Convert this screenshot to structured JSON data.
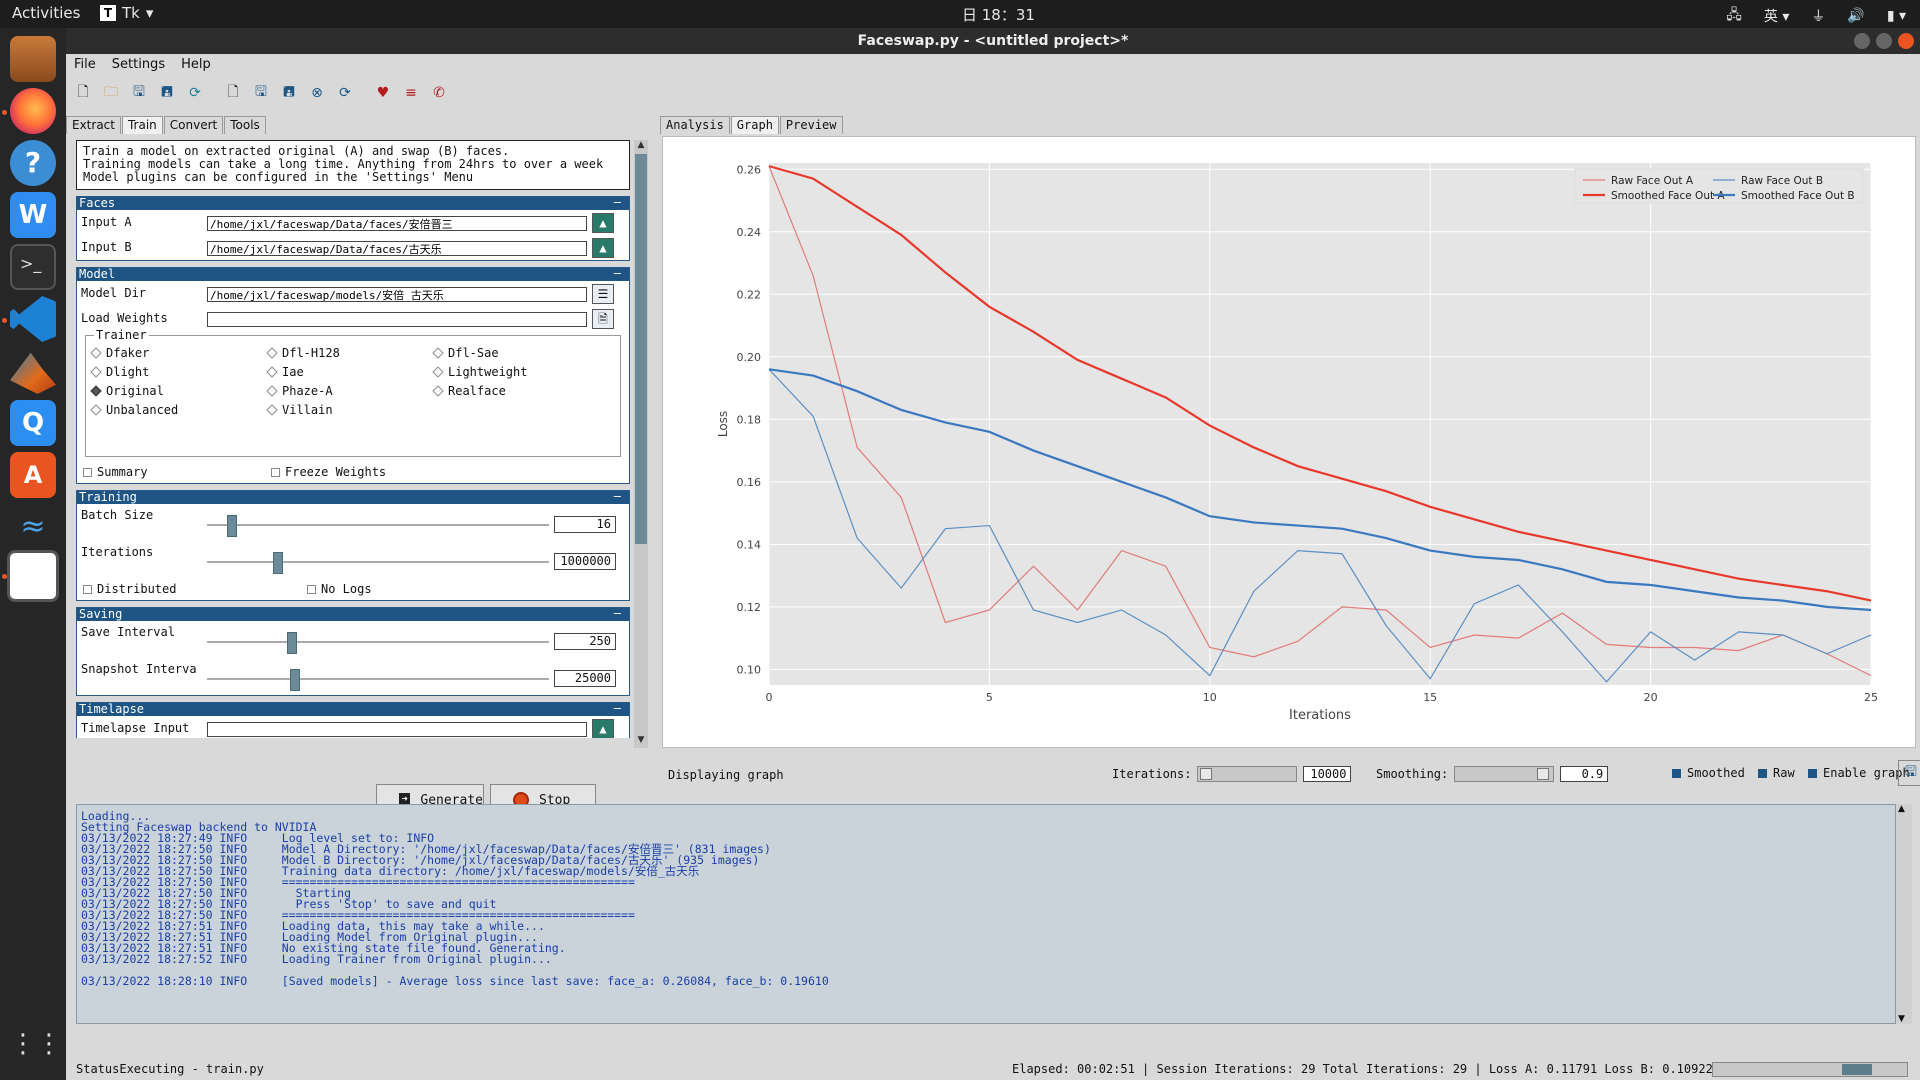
{
  "topbar": {
    "activities": "Activities",
    "app": "Tk",
    "clock": "日 18：31",
    "input_method": "英"
  },
  "dock": {
    "items": [
      "files-icon",
      "firefox-icon",
      "help-icon",
      "wps-icon",
      "terminal-icon",
      "vscode-icon",
      "matlab-icon",
      "qq-icon",
      "software-icon",
      "kali-icon",
      "faceswap-icon",
      "apps-grid-icon"
    ]
  },
  "window": {
    "title": "Faceswap.py - <untitled project>*"
  },
  "menu": {
    "file": "File",
    "settings": "Settings",
    "help": "Help"
  },
  "tabs_left": [
    "Extract",
    "Train",
    "Convert",
    "Tools"
  ],
  "tabs_right": [
    "Analysis",
    "Graph",
    "Preview"
  ],
  "description": {
    "l1": "Train a model on extracted original (A) and swap (B) faces.",
    "l2": "Training models can take a long time. Anything from 24hrs to over a week",
    "l3": "Model plugins can be configured in the 'Settings' Menu"
  },
  "faces": {
    "title": "Faces",
    "input_a_label": "Input A",
    "input_a": "/home/jxl/faceswap/Data/faces/安倍晋三",
    "input_b_label": "Input B",
    "input_b": "/home/jxl/faceswap/Data/faces/古天乐"
  },
  "model": {
    "title": "Model",
    "dir_label": "Model Dir",
    "dir": "/home/jxl/faceswap/models/安倍_古天乐",
    "weights_label": "Load Weights",
    "weights": "",
    "trainer_label": "Trainer",
    "trainers": [
      "Dfaker",
      "Dlight",
      "Original",
      "Unbalanced",
      "Dfl-H128",
      "Iae",
      "Phaze-A",
      "Villain",
      "Dfl-Sae",
      "Lightweight",
      "Realface"
    ],
    "selected_trainer": "Original",
    "summary": "Summary",
    "freeze": "Freeze Weights"
  },
  "training": {
    "title": "Training",
    "batch_label": "Batch Size",
    "batch": "16",
    "batch_level": 0.06,
    "iter_label": "Iterations",
    "iter": "1000000",
    "iter_level": 0.2,
    "distributed": "Distributed",
    "nologs": "No Logs"
  },
  "saving": {
    "title": "Saving",
    "save_label": "Save Interval",
    "save": "250",
    "save_level": 0.24,
    "snap_label": "Snapshot Interva",
    "snap": "25000",
    "snap_level": 0.25
  },
  "timelapse": {
    "title": "Timelapse",
    "input_label": "Timelapse Input"
  },
  "buttons": {
    "generate": "Generate",
    "stop": "Stop"
  },
  "graphbar": {
    "status": "Displaying graph",
    "iter_label": "Iterations:",
    "iter": "10000",
    "smooth_label": "Smoothing:",
    "smooth": "0.9",
    "cb_smoothed": "Smoothed",
    "cb_raw": "Raw",
    "cb_enable": "Enable graph"
  },
  "chart_data": {
    "type": "line",
    "xlabel": "Iterations",
    "ylabel": "Loss",
    "xlim": [
      0,
      25
    ],
    "ylim": [
      0.095,
      0.262
    ],
    "xticks": [
      0,
      5,
      10,
      15,
      20,
      25
    ],
    "yticks": [
      0.1,
      0.12,
      0.14,
      0.16,
      0.18,
      0.2,
      0.22,
      0.24,
      0.26
    ],
    "grid": true,
    "legend_position": "top-right",
    "x": [
      0,
      1,
      2,
      3,
      4,
      5,
      6,
      7,
      8,
      9,
      10,
      11,
      12,
      13,
      14,
      15,
      16,
      17,
      18,
      19,
      20,
      21,
      22,
      23,
      24,
      25
    ],
    "series": [
      {
        "name": "Raw Face Out A",
        "color": "#e27b7b",
        "width": 1.2,
        "values": [
          0.261,
          0.226,
          0.171,
          0.155,
          0.115,
          0.119,
          0.133,
          0.119,
          0.138,
          0.133,
          0.107,
          0.104,
          0.109,
          0.12,
          0.119,
          0.107,
          0.111,
          0.11,
          0.118,
          0.108,
          0.107,
          0.107,
          0.106,
          0.111,
          0.105,
          0.098
        ]
      },
      {
        "name": "Raw Face Out B",
        "color": "#5b8fc4",
        "width": 1.2,
        "values": [
          0.196,
          0.181,
          0.142,
          0.126,
          0.145,
          0.146,
          0.119,
          0.115,
          0.119,
          0.111,
          0.098,
          0.125,
          0.138,
          0.137,
          0.114,
          0.097,
          0.121,
          0.127,
          0.112,
          0.096,
          0.112,
          0.103,
          0.112,
          0.111,
          0.105,
          0.111
        ]
      },
      {
        "name": "Smoothed Face Out A",
        "color": "#e8382c",
        "width": 2.2,
        "values": [
          0.261,
          0.257,
          0.248,
          0.239,
          0.227,
          0.216,
          0.208,
          0.199,
          0.193,
          0.187,
          0.178,
          0.171,
          0.165,
          0.161,
          0.157,
          0.152,
          0.148,
          0.144,
          0.141,
          0.138,
          0.135,
          0.132,
          0.129,
          0.127,
          0.125,
          0.122
        ]
      },
      {
        "name": "Smoothed Face Out B",
        "color": "#3a78c0",
        "width": 2.2,
        "values": [
          0.196,
          0.194,
          0.189,
          0.183,
          0.179,
          0.176,
          0.17,
          0.165,
          0.16,
          0.155,
          0.149,
          0.147,
          0.146,
          0.145,
          0.142,
          0.138,
          0.136,
          0.135,
          0.132,
          0.128,
          0.127,
          0.125,
          0.123,
          0.122,
          0.12,
          0.119
        ]
      }
    ]
  },
  "console": [
    "Loading...",
    "Setting Faceswap backend to NVIDIA",
    "03/13/2022 18:27:49 INFO     Log level set to: INFO",
    "03/13/2022 18:27:50 INFO     Model A Directory: '/home/jxl/faceswap/Data/faces/安倍晋三' (831 images)",
    "03/13/2022 18:27:50 INFO     Model B Directory: '/home/jxl/faceswap/Data/faces/古天乐' (935 images)",
    "03/13/2022 18:27:50 INFO     Training data directory: /home/jxl/faceswap/models/安倍_古天乐",
    "03/13/2022 18:27:50 INFO     ===================================================",
    "03/13/2022 18:27:50 INFO       Starting",
    "03/13/2022 18:27:50 INFO       Press 'Stop' to save and quit",
    "03/13/2022 18:27:50 INFO     ===================================================",
    "03/13/2022 18:27:51 INFO     Loading data, this may take a while...",
    "03/13/2022 18:27:51 INFO     Loading Model from Original plugin...",
    "03/13/2022 18:27:51 INFO     No existing state file found. Generating.",
    "03/13/2022 18:27:52 INFO     Loading Trainer from Original plugin...",
    "",
    "03/13/2022 18:28:10 INFO     [Saved models] - Average loss since last save: face_a: 0.26084, face_b: 0.19610"
  ],
  "statusbar": {
    "left": "StatusExecuting - train.py",
    "right": "Elapsed: 00:02:51 | Session Iterations: 29  Total Iterations: 29 | Loss A: 0.11791  Loss B: 0.10922",
    "progress_level": 0.16
  }
}
